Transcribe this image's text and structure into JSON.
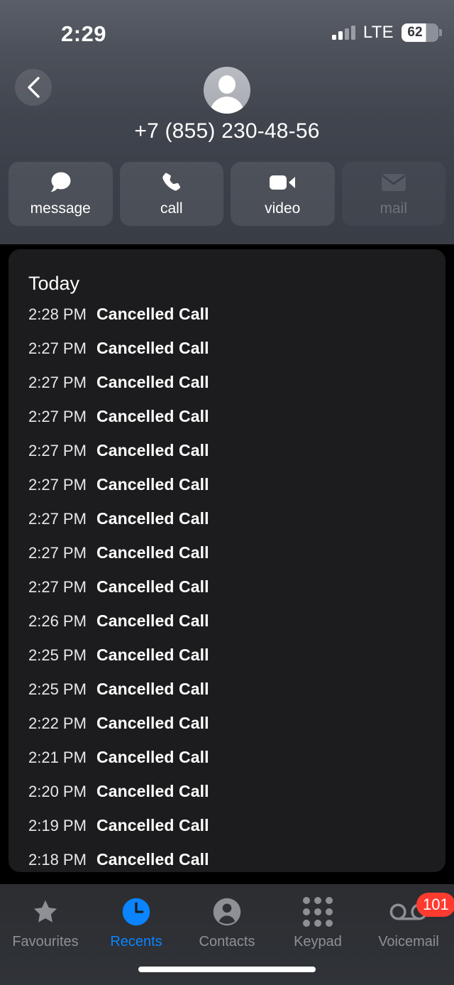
{
  "statusbar": {
    "time": "2:29",
    "network": "LTE",
    "battery_percent": "62",
    "signal_icon": "signal-bars-icon",
    "battery_icon": "battery-icon"
  },
  "header": {
    "back_icon": "chevron-left-icon",
    "avatar_icon": "contact-avatar-icon",
    "phone_number": "+7 (855) 230-48-56"
  },
  "actions": [
    {
      "label": "message",
      "icon": "message-bubble-icon",
      "disabled": false
    },
    {
      "label": "call",
      "icon": "phone-handset-icon",
      "disabled": false
    },
    {
      "label": "video",
      "icon": "video-camera-icon",
      "disabled": false
    },
    {
      "label": "mail",
      "icon": "envelope-icon",
      "disabled": true
    }
  ],
  "call_list": {
    "section_title": "Today",
    "rows": [
      {
        "time": "2:28 PM",
        "label": "Cancelled Call"
      },
      {
        "time": "2:27 PM",
        "label": "Cancelled Call"
      },
      {
        "time": "2:27 PM",
        "label": "Cancelled Call"
      },
      {
        "time": "2:27 PM",
        "label": "Cancelled Call"
      },
      {
        "time": "2:27 PM",
        "label": "Cancelled Call"
      },
      {
        "time": "2:27 PM",
        "label": "Cancelled Call"
      },
      {
        "time": "2:27 PM",
        "label": "Cancelled Call"
      },
      {
        "time": "2:27 PM",
        "label": "Cancelled Call"
      },
      {
        "time": "2:27 PM",
        "label": "Cancelled Call"
      },
      {
        "time": "2:26 PM",
        "label": "Cancelled Call"
      },
      {
        "time": "2:25 PM",
        "label": "Cancelled Call"
      },
      {
        "time": "2:25 PM",
        "label": "Cancelled Call"
      },
      {
        "time": "2:22 PM",
        "label": "Cancelled Call"
      },
      {
        "time": "2:21 PM",
        "label": "Cancelled Call"
      },
      {
        "time": "2:20 PM",
        "label": "Cancelled Call"
      },
      {
        "time": "2:19 PM",
        "label": "Cancelled Call"
      },
      {
        "time": "2:18 PM",
        "label": "Cancelled Call"
      }
    ]
  },
  "tabbar": {
    "items": [
      {
        "label": "Favourites",
        "icon": "star-icon",
        "active": false,
        "badge": ""
      },
      {
        "label": "Recents",
        "icon": "clock-icon",
        "active": true,
        "badge": ""
      },
      {
        "label": "Contacts",
        "icon": "person-icon",
        "active": false,
        "badge": ""
      },
      {
        "label": "Keypad",
        "icon": "keypad-grid-icon",
        "active": false,
        "badge": ""
      },
      {
        "label": "Voicemail",
        "icon": "voicemail-icon",
        "active": false,
        "badge": "101"
      }
    ]
  },
  "colors": {
    "accent": "#0a84ff",
    "badge": "#ff3b30",
    "card_bg": "#1c1c1e",
    "inactive_tab": "#8e9096"
  }
}
